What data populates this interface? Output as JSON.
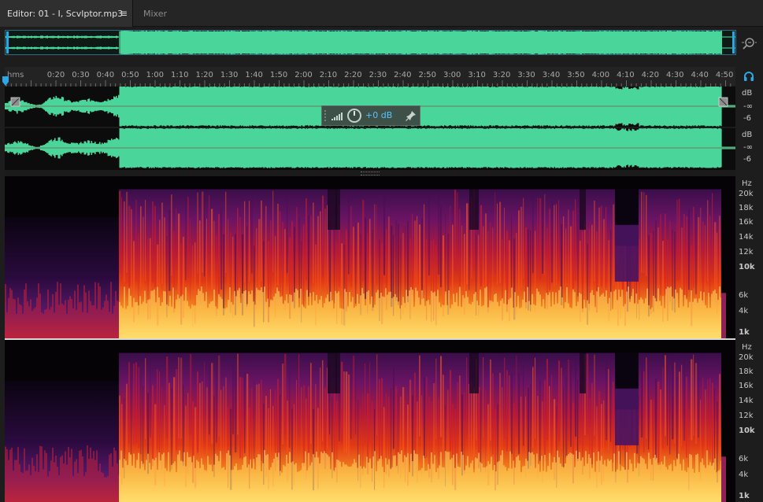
{
  "tabs": {
    "editor_label": "Editor: 01 - I, Scvlptor.mp3",
    "menu_glyph": "≡",
    "mixer_label": "Mixer"
  },
  "icons": {
    "zoom": "zoom-icon",
    "monitor": "headphones-icon",
    "playhead": "playhead-marker-icon",
    "hud_level": "level-bars-icon",
    "hud_knob": "volume-knob-icon",
    "hud_pin": "pin-icon"
  },
  "ruler": {
    "unit": "hms",
    "ticks": [
      "0:20",
      "0:30",
      "0:40",
      "0:50",
      "1:00",
      "1:10",
      "1:20",
      "1:30",
      "1:40",
      "1:50",
      "2:00",
      "2:10",
      "2:20",
      "2:30",
      "2:40",
      "2:50",
      "3:00",
      "3:10",
      "3:20",
      "3:30",
      "3:40",
      "3:50",
      "4:00",
      "4:10",
      "4:20",
      "4:30",
      "4:40",
      "4:50"
    ]
  },
  "hud": {
    "value": "+0 dB"
  },
  "db_scale": {
    "left": [
      "dB",
      "-∞",
      "-6"
    ],
    "right": [
      "dB",
      "-∞",
      "-6"
    ]
  },
  "hz_scale": {
    "left": [
      "Hz",
      "20k",
      "18k",
      "16k",
      "14k",
      "12k",
      "10k",
      "6k",
      "4k",
      "1k"
    ],
    "right": [
      "Hz",
      "20k",
      "18k",
      "16k",
      "14k",
      "12k",
      "10k",
      "6k",
      "4k",
      "1k"
    ]
  },
  "colors": {
    "waveform": "#4ad69a",
    "accent": "#2aa7e6",
    "spectrum_hot": "#ffd25a",
    "spectrum_mid": "#e0261a",
    "spectrum_cool": "#5a1a6a"
  }
}
